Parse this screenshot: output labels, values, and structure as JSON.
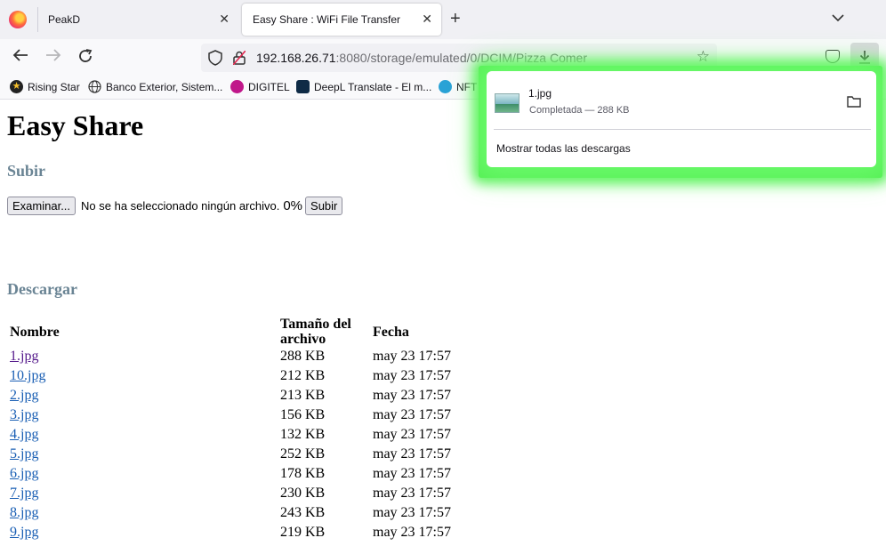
{
  "browser": {
    "tabs": [
      {
        "title": "PeakD",
        "active": false
      },
      {
        "title": "Easy Share : WiFi File Transfer",
        "active": true
      }
    ],
    "url": {
      "host": "192.168.26.71",
      "path": ":8080/storage/emulated/0/DCIM/Pizza Comer"
    },
    "bookmarks": [
      {
        "label": "Rising Star",
        "icon": "star-icon"
      },
      {
        "label": "Banco Exterior, Sistem...",
        "icon": "globe-icon"
      },
      {
        "label": "DIGITEL",
        "icon": "digitel-icon"
      },
      {
        "label": "DeepL Translate - El m...",
        "icon": "deepl-icon"
      },
      {
        "label": "NFT",
        "icon": "nft-icon"
      }
    ]
  },
  "downloads_panel": {
    "file_name": "1.jpg",
    "status": "Completada — 288 KB",
    "show_all": "Mostrar todas las descargas"
  },
  "page": {
    "title": "Easy Share",
    "upload_heading": "Subir",
    "browse_label": "Examinar...",
    "no_file_text": "No se ha seleccionado ningún archivo.",
    "progress": "0%",
    "submit_label": "Subir",
    "download_heading": "Descargar",
    "table": {
      "headers": [
        "Nombre",
        "Tamaño del archivo",
        "Fecha"
      ],
      "rows": [
        {
          "name": "1.jpg",
          "size": "288 KB",
          "date": "may 23 17:57",
          "visited": true
        },
        {
          "name": "10.jpg",
          "size": "212 KB",
          "date": "may 23 17:57",
          "visited": false
        },
        {
          "name": "2.jpg",
          "size": "213 KB",
          "date": "may 23 17:57",
          "visited": false
        },
        {
          "name": "3.jpg",
          "size": "156 KB",
          "date": "may 23 17:57",
          "visited": false
        },
        {
          "name": "4.jpg",
          "size": "132 KB",
          "date": "may 23 17:57",
          "visited": false
        },
        {
          "name": "5.jpg",
          "size": "252 KB",
          "date": "may 23 17:57",
          "visited": false
        },
        {
          "name": "6.jpg",
          "size": "178 KB",
          "date": "may 23 17:57",
          "visited": false
        },
        {
          "name": "7.jpg",
          "size": "230 KB",
          "date": "may 23 17:57",
          "visited": false
        },
        {
          "name": "8.jpg",
          "size": "243 KB",
          "date": "may 23 17:57",
          "visited": false
        },
        {
          "name": "9.jpg",
          "size": "219 KB",
          "date": "may 23 17:57",
          "visited": false
        }
      ]
    }
  },
  "colors": {
    "link": "#1a5fb4",
    "visited_link": "#551a8b",
    "heading": "#6a8494",
    "highlight": "#54ef54"
  }
}
